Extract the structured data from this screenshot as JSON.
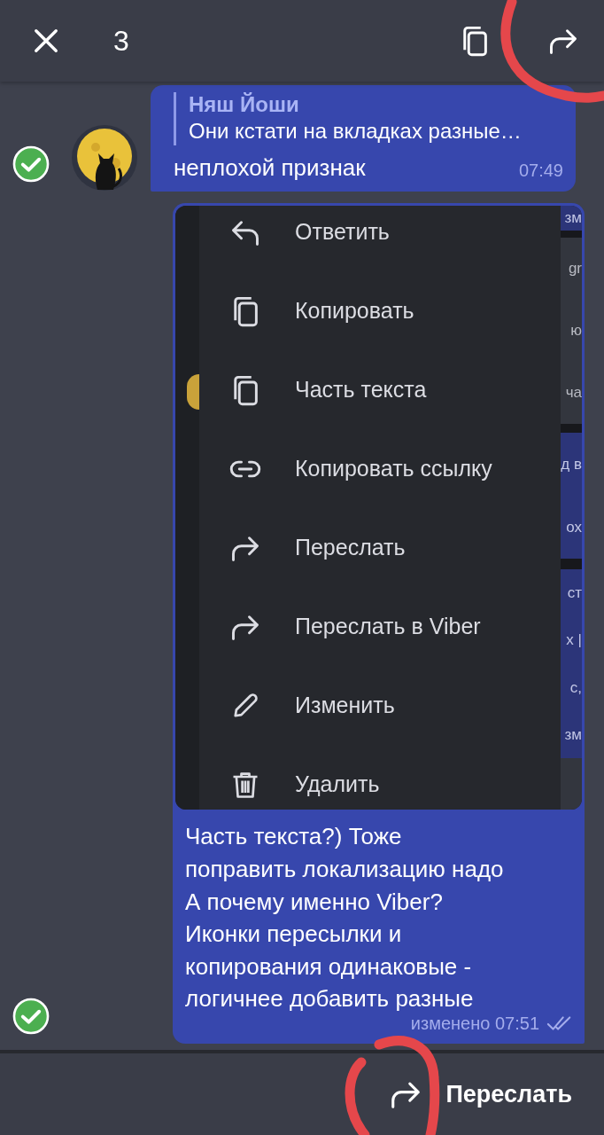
{
  "header": {
    "selected_count": "3",
    "annotated": true
  },
  "messages": [
    {
      "kind": "incoming",
      "selected": true,
      "reply": {
        "author": "Няш Йоши",
        "text": "Они кстати на вкладках разные…"
      },
      "text": "неплохой признак",
      "time": "07:49"
    },
    {
      "kind": "outgoing",
      "selected": true,
      "image": {
        "menu": [
          {
            "kind": "reply",
            "label": "Ответить"
          },
          {
            "kind": "copy",
            "label": "Копировать"
          },
          {
            "kind": "copy",
            "label": "Часть текста"
          },
          {
            "kind": "link",
            "label": "Копировать ссылку"
          },
          {
            "kind": "forward",
            "label": "Переслать"
          },
          {
            "kind": "forward",
            "label": "Переслать в Viber"
          },
          {
            "kind": "edit",
            "label": "Изменить"
          },
          {
            "kind": "delete",
            "label": "Удалить"
          }
        ],
        "edge": [
          {
            "kind": "bubble",
            "texts": [
              "зм"
            ]
          },
          {
            "kind": "gap"
          },
          {
            "kind": "panel",
            "texts": [
              "gr",
              "ю",
              "ча"
            ]
          },
          {
            "kind": "gap"
          },
          {
            "kind": "bubble",
            "texts": [
              "д в",
              "ох"
            ]
          },
          {
            "kind": "gap"
          },
          {
            "kind": "bubble",
            "texts": [
              "ст",
              "х |",
              "с,",
              "зм"
            ]
          },
          {
            "kind": "panel"
          }
        ]
      },
      "text": "Часть текста?) Тоже\nпоправить локализацию надо\nА почему именно Viber?\nИконки пересылки и\nкопирования одинаковые -\nлогичнее добавить разные",
      "time": "изменено 07:51",
      "read": true
    }
  ],
  "action_bar": {
    "label": "Переслать",
    "annotated": true
  }
}
